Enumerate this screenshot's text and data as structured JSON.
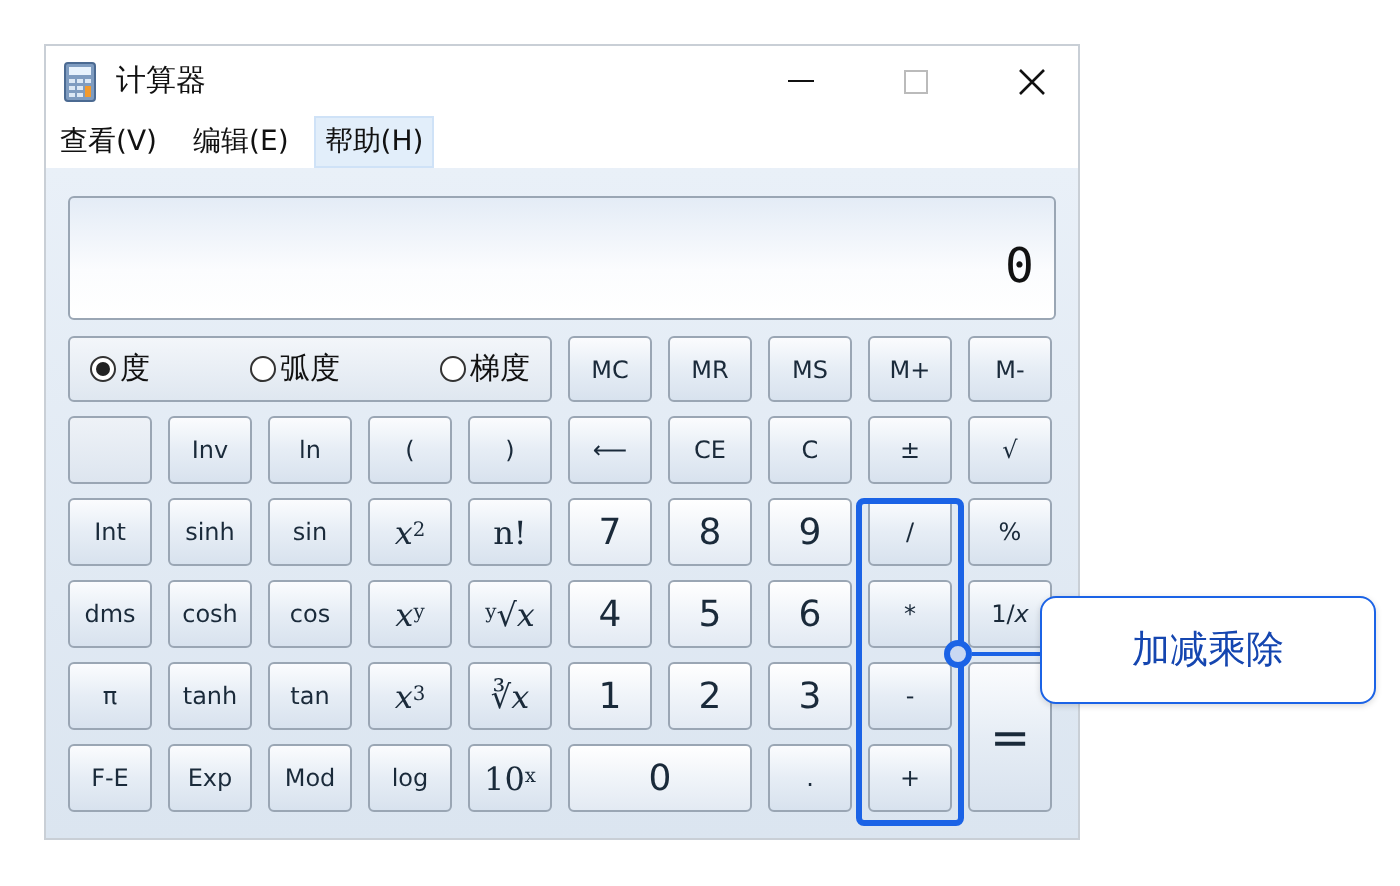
{
  "window": {
    "title": "计算器"
  },
  "menu": [
    {
      "label": "查看(V)",
      "selected": false
    },
    {
      "label": "编辑(E)",
      "selected": false
    },
    {
      "label": "帮助(H)",
      "selected": true
    }
  ],
  "display": {
    "value": "0"
  },
  "angle_units": [
    {
      "label": "度",
      "selected": true
    },
    {
      "label": "弧度",
      "selected": false
    },
    {
      "label": "梯度",
      "selected": false
    }
  ],
  "memory_buttons": [
    "MC",
    "MR",
    "MS",
    "M+",
    "M-"
  ],
  "keys": [
    {
      "kind": "blank"
    },
    {
      "kind": "function",
      "label": "Inv"
    },
    {
      "kind": "function",
      "label": "ln"
    },
    {
      "kind": "function",
      "label": "("
    },
    {
      "kind": "function",
      "label": ")"
    },
    {
      "kind": "function",
      "label": "⟵"
    },
    {
      "kind": "function",
      "label": "CE"
    },
    {
      "kind": "function",
      "label": "C"
    },
    {
      "kind": "function",
      "label": "±"
    },
    {
      "kind": "function",
      "label": "√"
    },
    {
      "kind": "function",
      "label": "Int"
    },
    {
      "kind": "function",
      "label": "sinh"
    },
    {
      "kind": "function",
      "label": "sin"
    },
    {
      "kind": "math",
      "label": "*x*$^{2}$"
    },
    {
      "kind": "math",
      "label": "n!"
    },
    {
      "kind": "digit",
      "label": "7"
    },
    {
      "kind": "digit",
      "label": "8"
    },
    {
      "kind": "digit",
      "label": "9"
    },
    {
      "kind": "function",
      "label": "/"
    },
    {
      "kind": "function",
      "label": "%"
    },
    {
      "kind": "function",
      "label": "dms"
    },
    {
      "kind": "function",
      "label": "cosh"
    },
    {
      "kind": "function",
      "label": "cos"
    },
    {
      "kind": "math",
      "label": "*x*$^{y}$"
    },
    {
      "kind": "math",
      "label": "$^{y}$√*x*"
    },
    {
      "kind": "digit",
      "label": "4"
    },
    {
      "kind": "digit",
      "label": "5"
    },
    {
      "kind": "digit",
      "label": "6"
    },
    {
      "kind": "function",
      "label": "*"
    },
    {
      "kind": "function",
      "label": "1/*x*"
    },
    {
      "kind": "function",
      "label": "π"
    },
    {
      "kind": "function",
      "label": "tanh"
    },
    {
      "kind": "function",
      "label": "tan"
    },
    {
      "kind": "math",
      "label": "*x*$^{3}$"
    },
    {
      "kind": "math",
      "label": "∛*x*"
    },
    {
      "kind": "digit",
      "label": "1"
    },
    {
      "kind": "digit",
      "label": "2"
    },
    {
      "kind": "digit",
      "label": "3"
    },
    {
      "kind": "function",
      "label": "-"
    },
    {
      "kind": "equals",
      "label": "="
    },
    {
      "kind": "function",
      "label": "F-E"
    },
    {
      "kind": "function",
      "label": "Exp"
    },
    {
      "kind": "function",
      "label": "Mod"
    },
    {
      "kind": "function",
      "label": "log"
    },
    {
      "kind": "math",
      "label": "10$^{x}$"
    },
    {
      "kind": "zero",
      "label": "0"
    },
    {
      "kind": "function",
      "label": "."
    },
    {
      "kind": "function",
      "label": "+"
    }
  ],
  "annotation": {
    "label": "加减乘除"
  }
}
